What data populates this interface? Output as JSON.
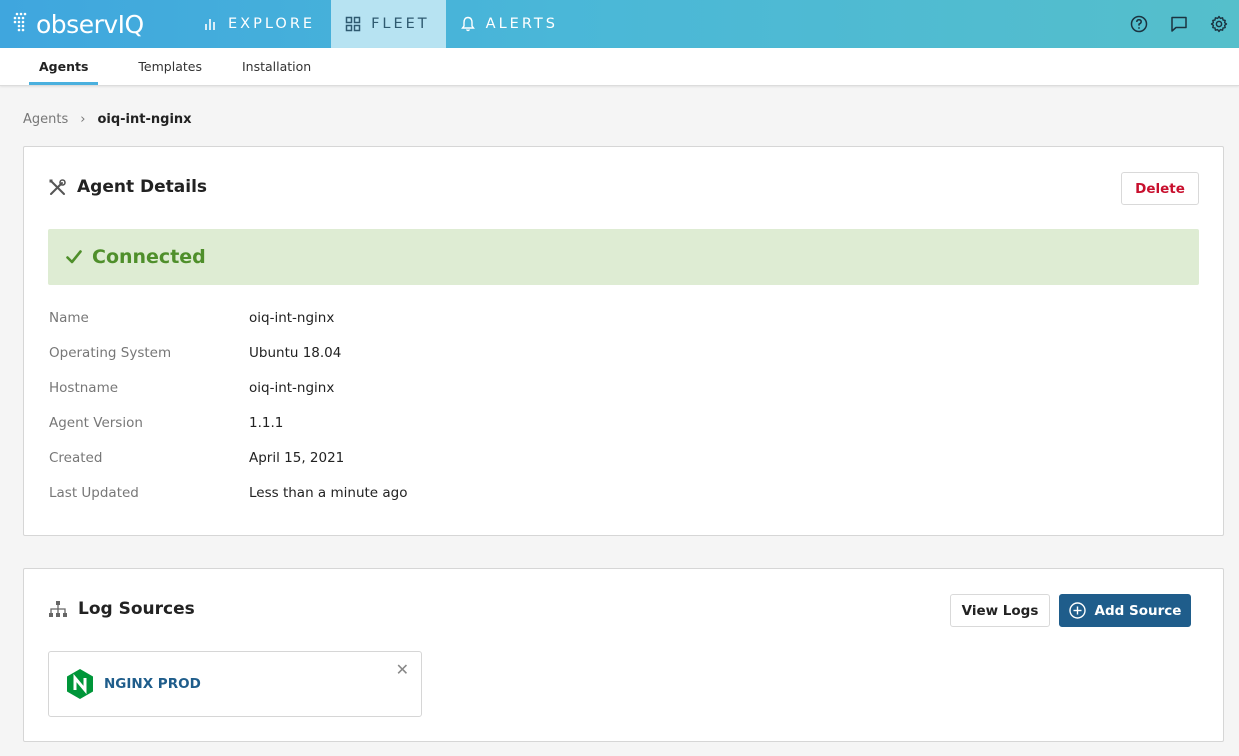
{
  "header": {
    "logo_text": "observIQ",
    "nav": [
      {
        "label": "EXPLORE",
        "icon": "bar-chart-icon",
        "active": false
      },
      {
        "label": "FLEET",
        "icon": "grid-icon",
        "active": true
      },
      {
        "label": "ALERTS",
        "icon": "bell-icon",
        "active": false
      }
    ],
    "right_icons": [
      "help-icon",
      "chat-icon",
      "gear-icon"
    ],
    "gradient_colors": [
      "#3fa6de",
      "#55bfcb"
    ]
  },
  "subnav": {
    "tabs": [
      {
        "label": "Agents",
        "active": true
      },
      {
        "label": "Templates",
        "active": false
      },
      {
        "label": "Installation",
        "active": false
      }
    ]
  },
  "breadcrumb": {
    "root": "Agents",
    "separator": "›",
    "current": "oiq-int-nginx"
  },
  "agent_details": {
    "title": "Agent Details",
    "delete_label": "Delete",
    "status": "Connected",
    "status_color": "#4f8f2b",
    "fields": [
      {
        "label": "Name",
        "value": "oiq-int-nginx"
      },
      {
        "label": "Operating System",
        "value": "Ubuntu 18.04"
      },
      {
        "label": "Hostname",
        "value": "oiq-int-nginx"
      },
      {
        "label": "Agent Version",
        "value": "1.1.1"
      },
      {
        "label": "Created",
        "value": "April 15, 2021"
      },
      {
        "label": "Last Updated",
        "value": "Less than a minute ago"
      }
    ]
  },
  "log_sources": {
    "title": "Log Sources",
    "view_logs_label": "View Logs",
    "add_source_label": "Add Source",
    "primary_color": "#1f5d8b",
    "sources": [
      {
        "name": "NGINX PROD",
        "icon": "nginx-logo-icon"
      }
    ]
  }
}
